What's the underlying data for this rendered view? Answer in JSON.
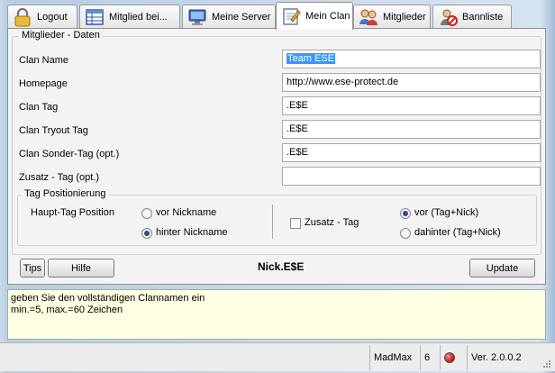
{
  "tabs": [
    {
      "label": "Logout",
      "icon": "lock-icon"
    },
    {
      "label": "Mitglied bei...",
      "icon": "table-icon"
    },
    {
      "label": "Meine Server",
      "icon": "monitor-icon"
    },
    {
      "label": "Mein Clan",
      "icon": "notepad-icon",
      "active": true
    },
    {
      "label": "Mitglieder",
      "icon": "users-icon"
    },
    {
      "label": "Bannliste",
      "icon": "banned-user-icon"
    }
  ],
  "group": {
    "title": "Mitglieder - Daten"
  },
  "fields": {
    "clan_name": {
      "label": "Clan Name",
      "value": "Team ESE"
    },
    "homepage": {
      "label": "Homepage",
      "value": "http://www.ese-protect.de"
    },
    "clan_tag": {
      "label": "Clan Tag",
      "value": ".E$E"
    },
    "tryout_tag": {
      "label": "Clan Tryout Tag",
      "value": ".E$E"
    },
    "sonder_tag": {
      "label": "Clan Sonder-Tag (opt.)",
      "value": ".E$E"
    },
    "zusatz_tag": {
      "label": "Zusatz - Tag (opt.)",
      "value": ""
    }
  },
  "tag_position": {
    "title": "Tag Positionierung",
    "haupt_label": "Haupt-Tag Position",
    "vor_nickname": "vor Nickname",
    "hinter_nickname": "hinter Nickname",
    "haupt_selected": "hinter Nickname",
    "zusatz_check_label": "Zusatz - Tag",
    "zusatz_checked": false,
    "vor_tag_nick": "vor (Tag+Nick)",
    "dahinter_tag_nick": "dahinter (Tag+Nick)",
    "zusatz_selected": "vor (Tag+Nick)"
  },
  "buttons": {
    "tips": "Tips",
    "hilfe": "Hilfe",
    "update": "Update"
  },
  "preview": "Nick.E$E",
  "info_text": {
    "line1": "geben Sie den vollständigen Clannamen ein",
    "line2": "min.=5, max.=60 Zeichen"
  },
  "status": {
    "user": "MadMax",
    "count": "6",
    "version": "Ver. 2.0.0.2"
  },
  "colors": {
    "selection": "#3399ff",
    "info_bg": "#ffffe1",
    "status_led": "#c62020"
  }
}
